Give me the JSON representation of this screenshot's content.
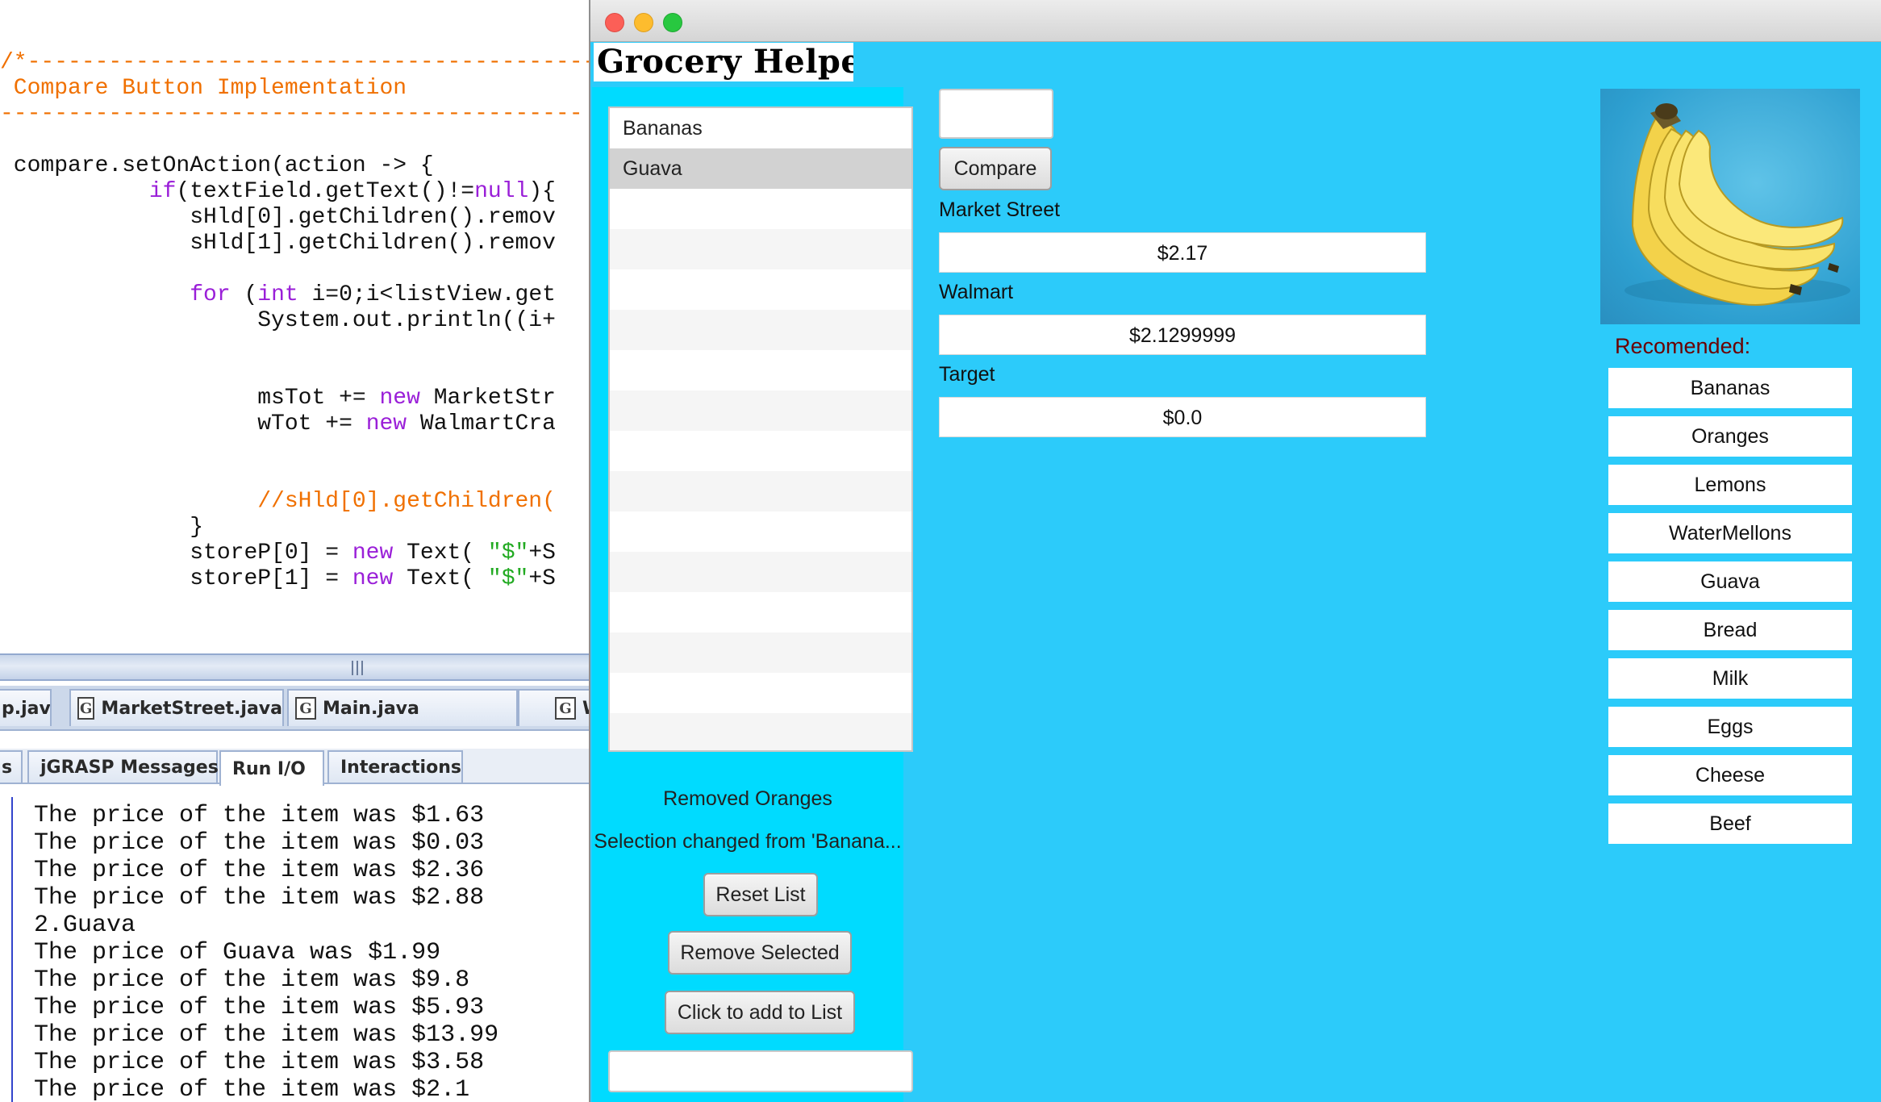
{
  "editor": {
    "code_lines": [
      "/*-------------------------------------------",
      " Compare Button Implementation",
      "-------------------------------------------",
      "",
      " compare.setOnAction(action -> {",
      "           if(textField.getText()!=null){",
      "              sHld[0].getChildren().remov",
      "              sHld[1].getChildren().remov",
      "",
      "              for (int i=0;i<listView.get",
      "                   System.out.println((i+",
      "",
      "",
      "                   msTot += new MarketStr",
      "                   wTot += new WalmartCra",
      "",
      "",
      "                   //sHld[0].getChildren(",
      "              }",
      "              storeP[0] = new Text( \"$\"+S",
      "              storeP[1] = new Text( \"$\"+S"
    ],
    "file_tabs": [
      "p.java",
      "MarketStreet.java",
      "Main.java",
      "W"
    ],
    "file_icon_letter": "G",
    "message_tabs": [
      "s",
      "jGRASP Messages",
      "Run I/O",
      "Interactions"
    ],
    "active_message_tab": "Run I/O",
    "console_lines": [
      "The price of the item was $1.63",
      "The price of the item was $0.03",
      "The price of the item was $2.36",
      "The price of the item was $2.88",
      "2.Guava",
      "The price of Guava was $1.99",
      "The price of the item was $9.8",
      "The price of the item was $5.93",
      "The price of the item was $13.99",
      "The price of the item was $3.58",
      "The price of the item was $2.1"
    ],
    "colors": {
      "keyword": "#9a1fd8",
      "comment": "#f07000",
      "string": "#22aa22"
    }
  },
  "app": {
    "title": "Grocery Helper",
    "background_color": "#2ccbfa",
    "panel_color": "#00dbff",
    "list_items": [
      "Bananas",
      "Guava"
    ],
    "selected_item": "Guava",
    "status_removed": "Removed Oranges",
    "status_selection": "Selection changed from 'Banana...",
    "buttons": {
      "reset": "Reset List",
      "remove": "Remove Selected",
      "add": "Click to add to List",
      "compare": "Compare"
    },
    "add_input_value": "",
    "compare_input_value": "",
    "stores": [
      {
        "name": "Market Street",
        "price": "$2.17"
      },
      {
        "name": "Walmart",
        "price": "$2.1299999"
      },
      {
        "name": "Target",
        "price": "$0.0"
      }
    ],
    "image_subject": "bananas",
    "recommended_label": "Recomended:",
    "recommended_color": "#6b0000",
    "recommended": [
      "Bananas",
      "Oranges",
      "Lemons",
      "WaterMellons",
      "Guava",
      "Bread",
      "Milk",
      "Eggs",
      "Cheese",
      "Beef"
    ]
  }
}
